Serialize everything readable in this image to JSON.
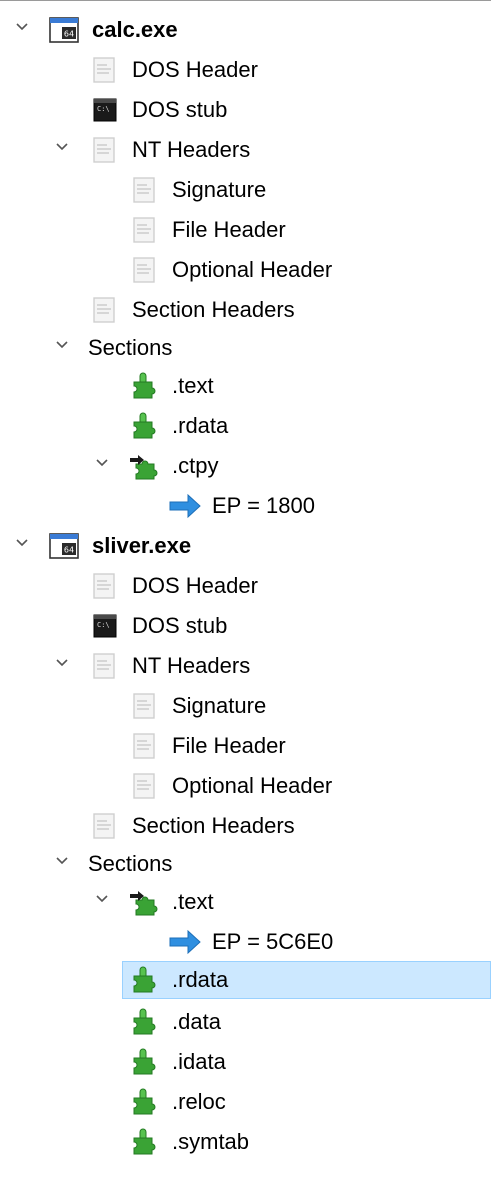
{
  "tree": {
    "calc": {
      "name": "calc.exe",
      "dos_header": "DOS Header",
      "dos_stub": "DOS stub",
      "nt_headers": "NT Headers",
      "signature": "Signature",
      "file_header": "File Header",
      "optional_header": "Optional Header",
      "section_headers": "Section Headers",
      "sections": "Sections",
      "sec_text": ".text",
      "sec_rdata": ".rdata",
      "sec_ctpy": ".ctpy",
      "ep": "EP = 1800"
    },
    "sliver": {
      "name": "sliver.exe",
      "dos_header": "DOS Header",
      "dos_stub": "DOS stub",
      "nt_headers": "NT Headers",
      "signature": "Signature",
      "file_header": "File Header",
      "optional_header": "Optional Header",
      "section_headers": "Section Headers",
      "sections": "Sections",
      "sec_text": ".text",
      "ep": "EP = 5C6E0",
      "sec_rdata": ".rdata",
      "sec_data": ".data",
      "sec_idata": ".idata",
      "sec_reloc": ".reloc",
      "sec_symtab": ".symtab"
    },
    "selected": "sliver.sec_rdata"
  },
  "icons": {
    "exe": "exe-64-icon",
    "header": "document-icon",
    "stub": "console-icon",
    "section": "puzzle-piece-icon",
    "entry_section": "puzzle-piece-arrow-icon",
    "entry_point": "blue-arrow-icon",
    "expand": "chevron-down-icon"
  },
  "colors": {
    "selection_bg": "#cce8ff",
    "selection_border": "#99d1ff",
    "puzzle_green": "#3aa335",
    "arrow_blue": "#2f8fe0"
  }
}
